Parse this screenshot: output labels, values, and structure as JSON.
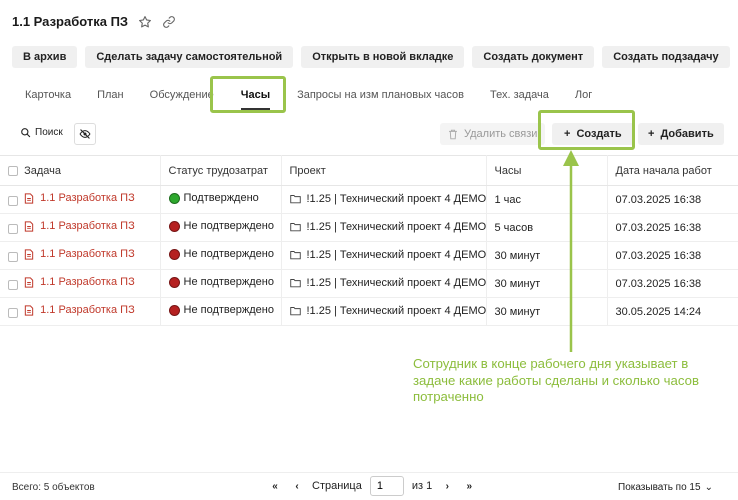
{
  "header": {
    "title": "1.1 Разработка ПЗ"
  },
  "actions": [
    "В архив",
    "Сделать задачу самостоятельной",
    "Открыть в новой вкладке",
    "Создать документ",
    "Создать подзадачу"
  ],
  "tabs": [
    "Карточка",
    "План",
    "Обсуждение",
    "Часы",
    "Запросы на изм плановых часов",
    "Тех. задача",
    "Лог"
  ],
  "active_tab": "Часы",
  "toolbar": {
    "search_label": "Поиск",
    "unlink_label": "Удалить связи",
    "create_label": "Создать",
    "add_label": "Добавить"
  },
  "table": {
    "columns": [
      "Задача",
      "Статус трудозатрат",
      "Проект",
      "Часы",
      "Дата начала работ"
    ],
    "rows": [
      {
        "task": "1.1 Разработка ПЗ",
        "status": "Подтверждено",
        "project": "!1.25 | Технический проект 4 ДЕМО",
        "hours": "1 час",
        "date": "07.03.2025 16:38"
      },
      {
        "task": "1.1 Разработка ПЗ",
        "status": "Не подтверждено",
        "project": "!1.25 | Технический проект 4 ДЕМО",
        "hours": "5 часов",
        "date": "07.03.2025 16:38"
      },
      {
        "task": "1.1 Разработка ПЗ",
        "status": "Не подтверждено",
        "project": "!1.25 | Технический проект 4 ДЕМО",
        "hours": "30 минут",
        "date": "07.03.2025 16:38"
      },
      {
        "task": "1.1 Разработка ПЗ",
        "status": "Не подтверждено",
        "project": "!1.25 | Технический проект 4 ДЕМО",
        "hours": "30 минут",
        "date": "07.03.2025 16:38"
      },
      {
        "task": "1.1 Разработка ПЗ",
        "status": "Не подтверждено",
        "project": "!1.25 | Технический проект 4 ДЕМО",
        "hours": "30 минут",
        "date": "30.05.2025 14:24"
      }
    ]
  },
  "status_colors": {
    "confirmed": "#2ea82e",
    "unconfirmed": "#b52020"
  },
  "annotation": "Сотрудник в конце рабочего дня указывает в задаче какие работы сделаны и сколько часов потраченно",
  "accent_color": "#9ac44b",
  "footer": {
    "total": "Всего: 5 объектов",
    "page_label": "Страница",
    "page_value": "1",
    "of_label": "из 1",
    "per_page": "Показывать по 15"
  }
}
